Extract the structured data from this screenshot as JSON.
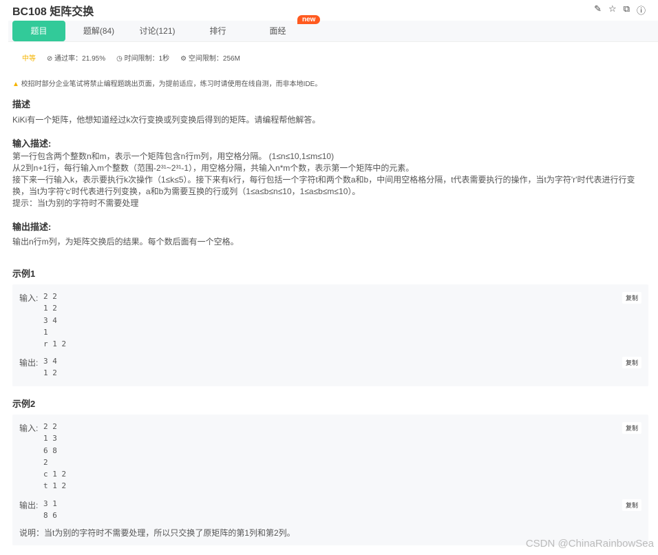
{
  "header": {
    "title": "BC108  矩阵交换",
    "icons": [
      "edit-icon",
      "star-icon",
      "external-link-icon",
      "info-icon"
    ]
  },
  "tabs": [
    {
      "label": "题目"
    },
    {
      "label": "题解(84)"
    },
    {
      "label": "讨论(121)"
    },
    {
      "label": "排行"
    },
    {
      "label": "面经"
    }
  ],
  "new_badge": "new",
  "info": {
    "difficulty": "中等",
    "pass_rate": "通过率：21.95%",
    "time_limit": "时间限制：1秒",
    "space_limit": "空间限制：256M"
  },
  "warning": "校招时部分企业笔试将禁止编程题跳出页面，为提前适应，练习时请使用在线自测，而非本地IDE。",
  "desc": {
    "heading": "描述",
    "text": "KiKi有一个矩阵，他想知道经过k次行变换或列变换后得到的矩阵。请编程帮他解答。"
  },
  "input_desc": {
    "heading": "输入描述:",
    "lines": [
      "第一行包含两个整数n和m，表示一个矩阵包含n行m列，用空格分隔。 (1≤n≤10,1≤m≤10)",
      "从2到n+1行，每行输入m个整数（范围-2³¹~2³¹-1），用空格分隔，共输入n*m个数，表示第一个矩阵中的元素。",
      "接下来一行输入k，表示要执行k次操作（1≤k≤5）。接下来有k行，每行包括一个字符t和两个数a和b，中间用空格格分隔，t代表需要执行的操作，当t为字符'r'时代表进行行变换，当t为字符'c'时代表进行列变换，a和b为需要互换的行或列（1≤a≤b≤n≤10，1≤a≤b≤m≤10）。",
      "提示：当t为别的字符时不需要处理"
    ]
  },
  "output_desc": {
    "heading": "输出描述:",
    "text": "输出n行m列，为矩阵交换后的结果。每个数后面有一个空格。"
  },
  "examples": [
    {
      "heading": "示例1",
      "input_label": "输入:",
      "input": "2 2\n1 2\n3 4\n1\nr 1 2",
      "output_label": "输出:",
      "output": "3 4\n1 2",
      "copy": "复制"
    },
    {
      "heading": "示例2",
      "input_label": "输入:",
      "input": "2 2\n1 3\n6 8\n2\nc 1 2\nt 1 2",
      "output_label": "输出:",
      "output": "3 1\n8 6",
      "copy": "复制",
      "note": "说明：当t为别的字符时不需要处理，所以只交换了原矩阵的第1列和第2列。"
    }
  ],
  "watermark": "CSDN @ChinaRainbowSea"
}
